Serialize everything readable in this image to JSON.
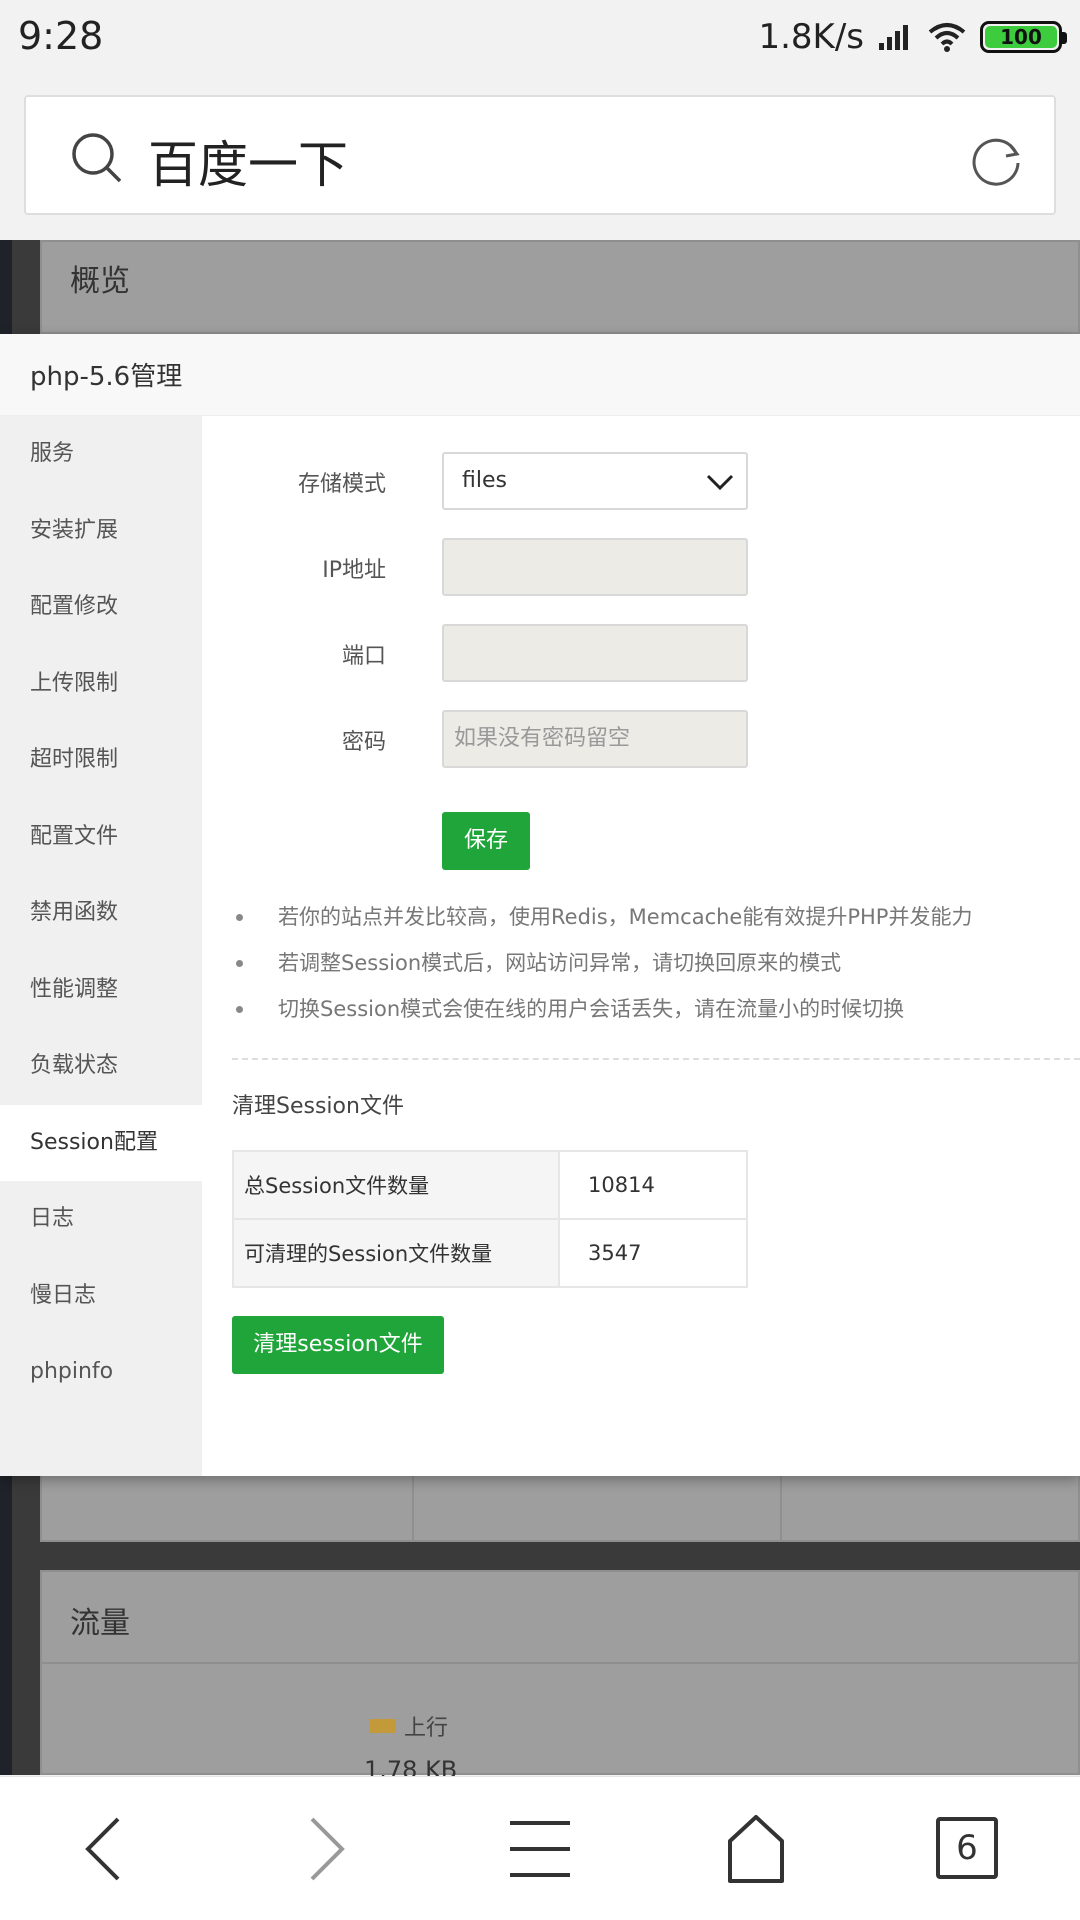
{
  "status_bar": {
    "time": "9:28",
    "net_speed": "1.8K/s",
    "battery": "100"
  },
  "browser": {
    "search_text": "百度一下",
    "tab_count": "6"
  },
  "background": {
    "overview_title": "概览",
    "traffic_title": "流量",
    "legend_upload": "上行",
    "traffic_value": "1.78 KB"
  },
  "modal": {
    "title": "php-5.6管理",
    "sidebar": [
      {
        "label": "服务"
      },
      {
        "label": "安装扩展"
      },
      {
        "label": "配置修改"
      },
      {
        "label": "上传限制"
      },
      {
        "label": "超时限制"
      },
      {
        "label": "配置文件"
      },
      {
        "label": "禁用函数"
      },
      {
        "label": "性能调整"
      },
      {
        "label": "负载状态"
      },
      {
        "label": "Session配置",
        "active": true
      },
      {
        "label": "日志"
      },
      {
        "label": "慢日志"
      },
      {
        "label": "phpinfo"
      }
    ],
    "form": {
      "storage_mode_label": "存储模式",
      "storage_mode_value": "files",
      "ip_label": "IP地址",
      "ip_value": "",
      "port_label": "端口",
      "port_value": "",
      "password_label": "密码",
      "password_placeholder": "如果没有密码留空",
      "save_label": "保存"
    },
    "tips": [
      "若你的站点并发比较高，使用Redis，Memcache能有效提升PHP并发能力",
      "若调整Session模式后，网站访问异常，请切换回原来的模式",
      "切换Session模式会使在线的用户会话丢失，请在流量小的时候切换"
    ],
    "cleanup": {
      "section_title": "清理Session文件",
      "rows": [
        {
          "key": "总Session文件数量",
          "value": "10814"
        },
        {
          "key": "可清理的Session文件数量",
          "value": "3547"
        }
      ],
      "button_label": "清理session文件"
    }
  },
  "colors": {
    "accent": "#20a53a",
    "overlay": "#3a3a3a"
  }
}
